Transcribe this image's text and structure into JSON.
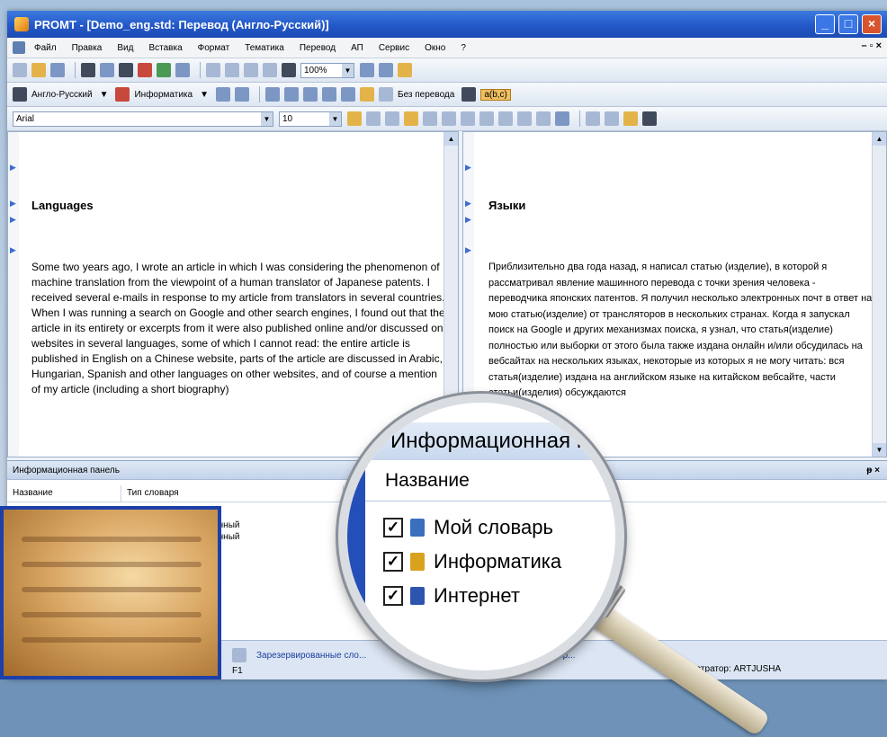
{
  "window": {
    "title": "PROMT - [Demo_eng.std: Перевод (Англо-Русский)]"
  },
  "menu": {
    "items": [
      "Файл",
      "Правка",
      "Вид",
      "Вставка",
      "Формат",
      "Тематика",
      "Перевод",
      "АП",
      "Сервис",
      "Окно",
      "?"
    ]
  },
  "toolbar": {
    "zoom": "100%",
    "direction": "Англо-Русский",
    "subject": "Информатика",
    "no_translation": "Без перевода",
    "abc_label": "a(b,c)",
    "font": "Arial",
    "font_size": "10"
  },
  "source": {
    "heading": "Languages",
    "paragraph": "Some two years ago, I wrote an article in which I was considering the phenomenon of machine translation from the viewpoint of a human translator of Japanese patents. I received several e-mails in response to my article from translators in several countries. When I was running a search on Google and other search engines, I found out that the article in its entirety or excerpts from it were also published online and/or discussed on websites in several languages, some of which I cannot read: the entire article is published in English on a Chinese website, parts of the article are discussed in Arabic, Hungarian, Spanish and other languages on other websites, and of course a mention of my article (including a short biography)"
  },
  "target": {
    "heading": "Языки",
    "paragraph": "Приблизительно два года назад, я написал статью (изделие), в которой я рассматривал явление машинного перевода с точки зрения человека - переводчика японских патентов. Я получил несколько электронных почт в ответ на мою статью(изделие) от трансляторов в нескольких странах. Когда я запускал поиск на Google и других механизмах поиска, я узнал, что статья(изделие) полностью или выборки от этого была также издана онлайн и/или обсудилась на вебсайтах на нескольких языках, некоторые из которых я не могу читать: вся статья(изделие) издана на английском языке на китайском вебсайте, части статьи(изделия) обсуждаются"
  },
  "info_panel": {
    "title": "Информационная панель",
    "col_name": "Название",
    "col_type": "Тип словаря",
    "partial_items": [
      "...кий",
      "...ованный",
      "...ованный"
    ]
  },
  "status": {
    "reserved_tab": "Зарезервированные сло...",
    "search_tab": "...ка по словар...",
    "help_key": "F1",
    "user": "...истратор: ARTJUSHA"
  },
  "magnifier": {
    "panel_title": "Информационная па...",
    "column": "Название",
    "dictionaries": [
      {
        "label": "Мой словарь",
        "checked": true,
        "color": "#3a6fbf"
      },
      {
        "label": "Информатика",
        "checked": true,
        "color": "#d9a21e"
      },
      {
        "label": "Интернет",
        "checked": true,
        "color": "#2d55b0"
      }
    ]
  }
}
